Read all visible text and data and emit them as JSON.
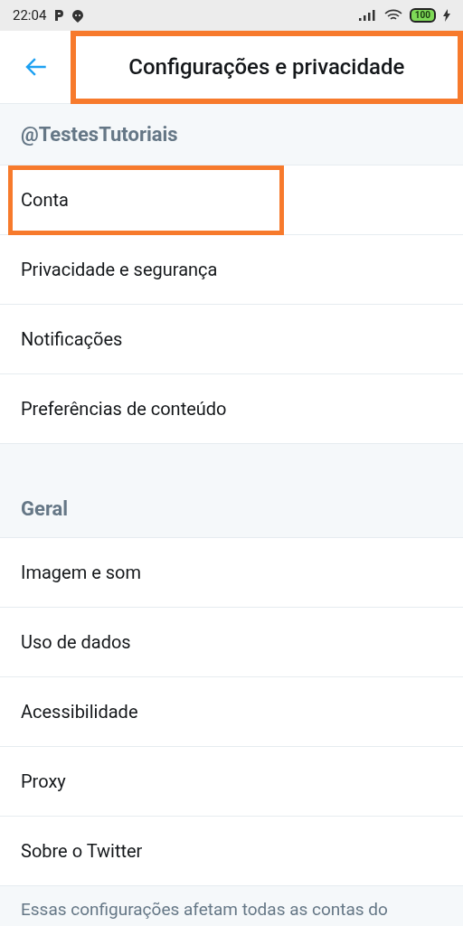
{
  "status_bar": {
    "time": "22:04",
    "battery": "100"
  },
  "header": {
    "title": "Configurações e privacidade",
    "highlighted": true
  },
  "sections": [
    {
      "title": "@TestesTutoriais",
      "items": [
        {
          "label": "Conta",
          "highlighted": true
        },
        {
          "label": "Privacidade e segurança",
          "highlighted": false
        },
        {
          "label": "Notificações",
          "highlighted": false
        },
        {
          "label": "Preferências de conteúdo",
          "highlighted": false
        }
      ]
    },
    {
      "title": "Geral",
      "items": [
        {
          "label": "Imagem e som",
          "highlighted": false
        },
        {
          "label": "Uso de dados",
          "highlighted": false
        },
        {
          "label": "Acessibilidade",
          "highlighted": false
        },
        {
          "label": "Proxy",
          "highlighted": false
        },
        {
          "label": "Sobre o Twitter",
          "highlighted": false
        }
      ]
    }
  ],
  "footer_note": "Essas configurações afetam todas as contas do"
}
